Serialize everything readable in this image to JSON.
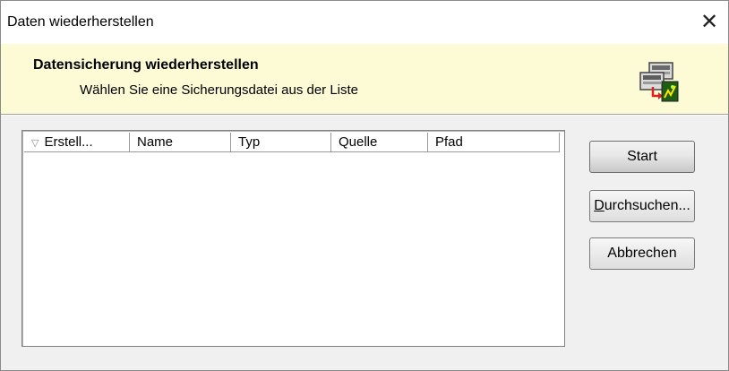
{
  "window": {
    "title": "Daten wiederherstellen",
    "close_glyph": "✕"
  },
  "banner": {
    "title": "Datensicherung wiederherstellen",
    "subtitle": "Wählen Sie eine Sicherungsdatei aus der Liste",
    "icon": "restore-backup-icon",
    "background": "#fdfbd6"
  },
  "list": {
    "columns": [
      {
        "label": "Erstell...",
        "sort_indicator": "▽"
      },
      {
        "label": "Name"
      },
      {
        "label": "Typ"
      },
      {
        "label": "Quelle"
      },
      {
        "label": "Pfad"
      }
    ],
    "rows": []
  },
  "buttons": {
    "start_label": "Start",
    "browse_label_mnemonic": "D",
    "browse_label_rest": "urchsuchen...",
    "cancel_label": "Abbrechen"
  }
}
